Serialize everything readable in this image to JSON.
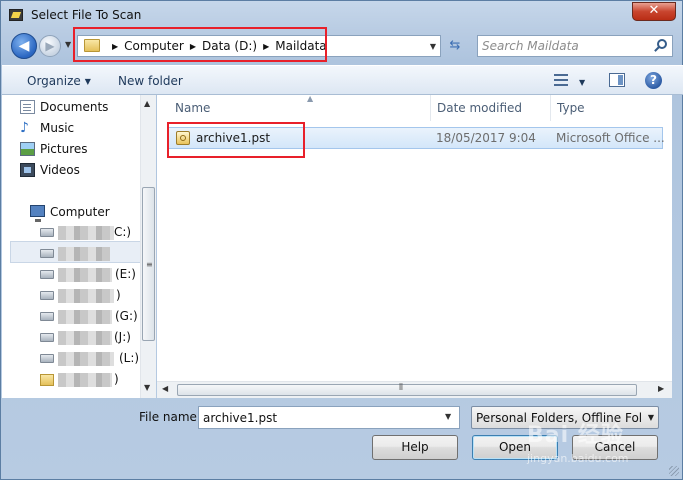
{
  "window": {
    "title": "Select File To Scan",
    "close_label": "✕"
  },
  "address": {
    "crumbs": [
      "Computer",
      "Data (D:)",
      "Maildata"
    ],
    "separator": "▶",
    "dropdown": "▼"
  },
  "search": {
    "placeholder": "Search Maildata"
  },
  "toolbar": {
    "organize": "Organize",
    "new_folder": "New folder",
    "help": "?"
  },
  "nav": {
    "favorites": [
      {
        "label": "Documents",
        "icon": "documents-icon"
      },
      {
        "label": "Music",
        "icon": "music-icon"
      },
      {
        "label": "Pictures",
        "icon": "pictures-icon"
      },
      {
        "label": "Videos",
        "icon": "videos-icon"
      }
    ],
    "computer": "Computer",
    "drives": [
      {
        "suffix": "C:)"
      },
      {
        "suffix": ""
      },
      {
        "suffix": "(E:)"
      },
      {
        "suffix": ")"
      },
      {
        "suffix": "(G:)"
      },
      {
        "suffix": "(J:)"
      },
      {
        "suffix": "(L:)"
      },
      {
        "suffix": ")"
      }
    ]
  },
  "files": {
    "columns": [
      "Name",
      "Date modified",
      "Type"
    ],
    "rows": [
      {
        "name": "archive1.pst",
        "date": "18/05/2017 9:04",
        "type": "Microsoft Office ..."
      }
    ]
  },
  "bottom": {
    "file_name_label": "File name:",
    "file_name_value": "archive1.pst",
    "file_type": "Personal Folders, Offline Folder",
    "help_button": "Help",
    "open_button": "Open",
    "cancel_button": "Cancel"
  },
  "watermark": {
    "text": "Bai 经验",
    "sub": "jingyan.baidu.com"
  },
  "colors": {
    "annotation": "#e8202a",
    "selection": "#d3e6f9",
    "chrome": "#b9cce3"
  }
}
